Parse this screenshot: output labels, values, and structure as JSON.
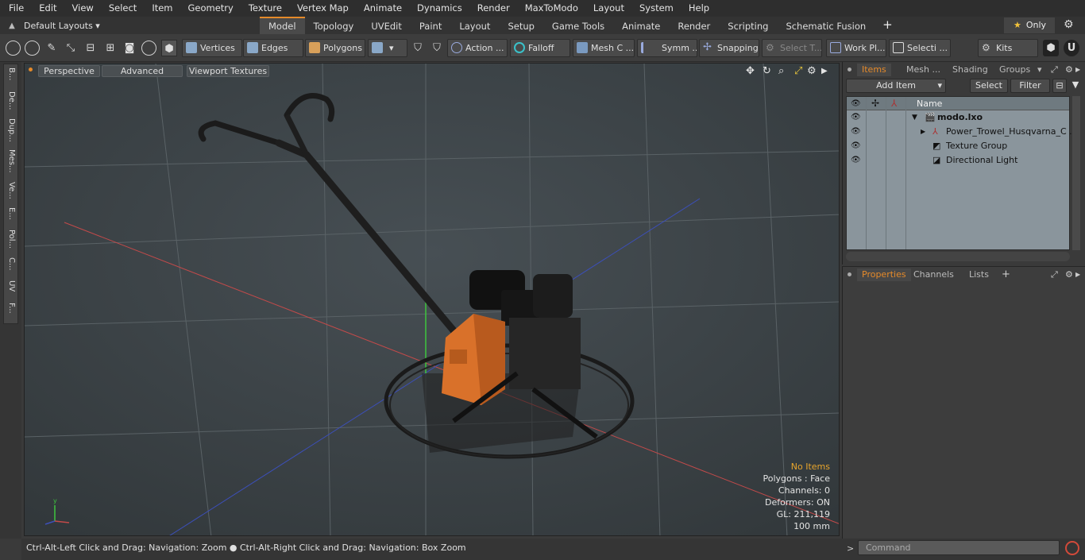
{
  "menu": [
    "File",
    "Edit",
    "View",
    "Select",
    "Item",
    "Geometry",
    "Texture",
    "Vertex Map",
    "Animate",
    "Dynamics",
    "Render",
    "MaxToModo",
    "Layout",
    "System",
    "Help"
  ],
  "layouts_label": "Default Layouts ▾",
  "tabs": [
    "Model",
    "Topology",
    "UVEdit",
    "Paint",
    "Layout",
    "Setup",
    "Game Tools",
    "Animate",
    "Render",
    "Scripting",
    "Schematic Fusion"
  ],
  "active_tab": "Model",
  "only_label": "Only",
  "toolbar": {
    "vertices": "Vertices",
    "edges": "Edges",
    "polygons": "Polygons",
    "action": "Action ...",
    "falloff": "Falloff",
    "mesh": "Mesh C ...",
    "symm": "Symm ...",
    "snapping": "Snapping",
    "select_t": "Select T...",
    "work_pl": "Work Pl...",
    "selecti": "Selecti ...",
    "kits": "Kits"
  },
  "left_tabs": [
    "B...",
    "De...",
    "Dup...",
    "Mes...",
    "Ve...",
    "E...",
    "Pol...",
    "C...",
    "UV",
    "F..."
  ],
  "viewport": {
    "perspective": "Perspective",
    "advanced": "Advanced",
    "textures": "Viewport Textures",
    "info": {
      "no_items": "No Items",
      "polygons": "Polygons : Face",
      "channels": "Channels: 0",
      "deformers": "Deformers: ON",
      "gl": "GL: 211,119",
      "scale": "100 mm"
    }
  },
  "status": "Ctrl-Alt-Left Click and Drag: Navigation: Zoom ● Ctrl-Alt-Right Click and Drag: Navigation: Box Zoom",
  "items_panel": {
    "tabs": [
      "Items",
      "Mesh ...",
      "Shading",
      "Groups"
    ],
    "add_item": "Add Item",
    "select": "Select",
    "filter": "Filter",
    "name_header": "Name",
    "rows": [
      "modo.lxo",
      "Power_Trowel_Husqvarna_C ...",
      "Texture Group",
      "Directional Light"
    ]
  },
  "props_panel": {
    "tabs": [
      "Properties",
      "Channels",
      "Lists"
    ]
  },
  "command_placeholder": "Command",
  "colors": {
    "accent": "#e58a2a",
    "highlight": "#e8a52c"
  }
}
